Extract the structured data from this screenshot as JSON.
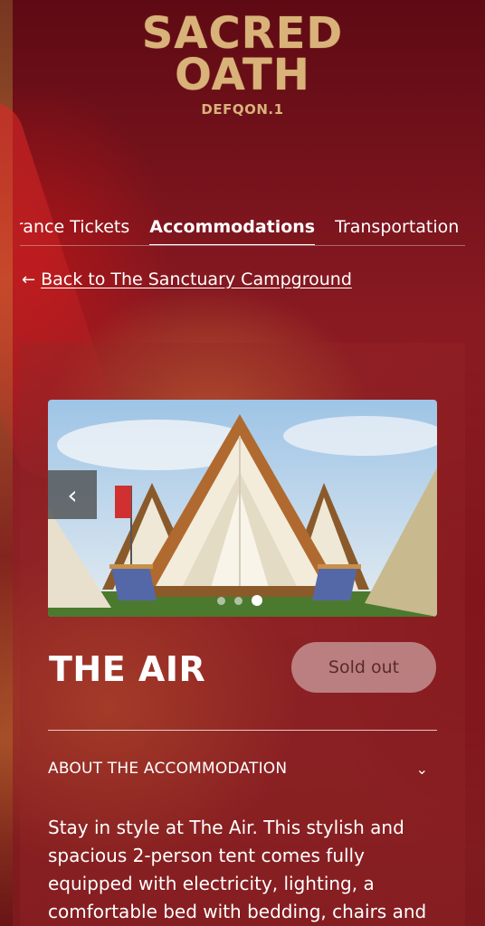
{
  "brand": {
    "logo_line1": "SACRED",
    "logo_line2": "OATH",
    "logo_sub": "DEFQON.1"
  },
  "tabs": [
    {
      "label": "Entrance Tickets",
      "active": false
    },
    {
      "label": "Accommodations",
      "active": true
    },
    {
      "label": "Transportation",
      "active": false
    }
  ],
  "back_link": {
    "icon": "arrow-left-icon",
    "label": "Back to The Sanctuary Campground"
  },
  "carousel": {
    "prev_icon": "chevron-left-icon",
    "slide_count": 3,
    "active_slide": 3,
    "image_alt": "A-frame tent with wooden beams, white canvas, beach chairs"
  },
  "accommodation": {
    "title": "THE AIR",
    "status": "Sold out",
    "section_label": "ABOUT THE ACCOMMODATION",
    "section_icon": "chevron-down-icon",
    "description": "Stay in style at The Air. This stylish and spacious 2-person tent comes fully equipped with electricity, lighting, a comfortable bed with bedding, chairs and"
  },
  "colors": {
    "accent_gold": "#d9b27a",
    "background": "#8a1a22",
    "badge_bg": "#dccaca",
    "badge_text": "#5a2a2a"
  }
}
